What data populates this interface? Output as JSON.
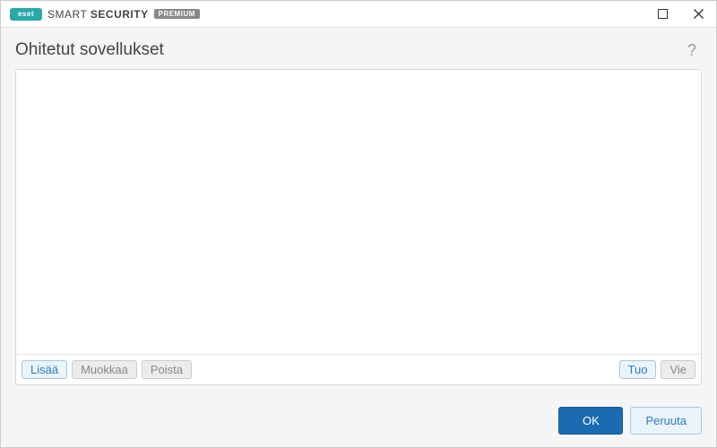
{
  "titlebar": {
    "logo_text": "eset",
    "brand_light": "SMART",
    "brand_bold": "SECURITY",
    "badge": "PREMIUM"
  },
  "header": {
    "title": "Ohitetut sovellukset"
  },
  "toolbar": {
    "add": "Lisää",
    "edit": "Muokkaa",
    "delete": "Poista",
    "import": "Tuo",
    "export": "Vie"
  },
  "footer": {
    "ok": "OK",
    "cancel": "Peruuta"
  }
}
